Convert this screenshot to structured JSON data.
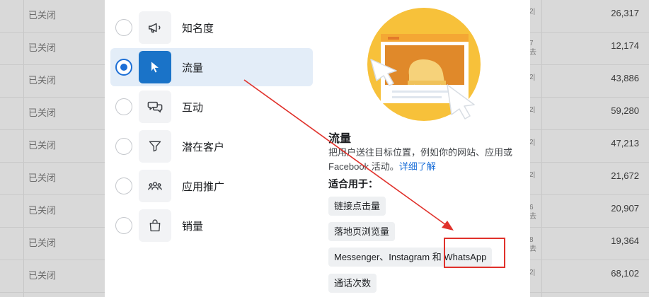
{
  "background_table": {
    "rows": [
      {
        "status": "已关闭",
        "value": "26,317"
      },
      {
        "status": "已关闭",
        "value": "12,174"
      },
      {
        "status": "已关闭",
        "value": "43,886"
      },
      {
        "status": "已关闭",
        "value": "59,280"
      },
      {
        "status": "已关闭",
        "value": "47,213"
      },
      {
        "status": "已关闭",
        "value": "21,672"
      },
      {
        "status": "已关闭",
        "value": "20,907"
      },
      {
        "status": "已关闭",
        "value": "19,364"
      },
      {
        "status": "已关闭",
        "value": "68,102"
      }
    ],
    "fragments": [
      "2|",
      "7",
      "去",
      "2|",
      "2|",
      "2|",
      "2|",
      "6",
      "去",
      "8",
      "去",
      "2|"
    ]
  },
  "objectives": [
    {
      "label": "知名度",
      "icon": "megaphone-icon",
      "selected": false
    },
    {
      "label": "流量",
      "icon": "cursor-icon",
      "selected": true
    },
    {
      "label": "互动",
      "icon": "chat-bubbles-icon",
      "selected": false
    },
    {
      "label": "潜在客户",
      "icon": "funnel-icon",
      "selected": false
    },
    {
      "label": "应用推广",
      "icon": "people-icon",
      "selected": false
    },
    {
      "label": "销量",
      "icon": "shopping-bag-icon",
      "selected": false
    }
  ],
  "detail": {
    "title": "流量",
    "description": "把用户送往目标位置，例如你的网站、应用或 Facebook 活动。",
    "learn_more": "详细了解",
    "suits_label": "适合用于：",
    "use_cases": [
      "链接点击量",
      "落地页浏览量",
      "Messenger、Instagram 和 WhatsApp",
      "通话次数"
    ]
  },
  "colors": {
    "accent": "#1a73c8",
    "selected_bg": "#e3edf8",
    "annotation_red": "#e0312b",
    "illustration_yellow": "#f7c13a",
    "illustration_orange": "#e0892a"
  }
}
